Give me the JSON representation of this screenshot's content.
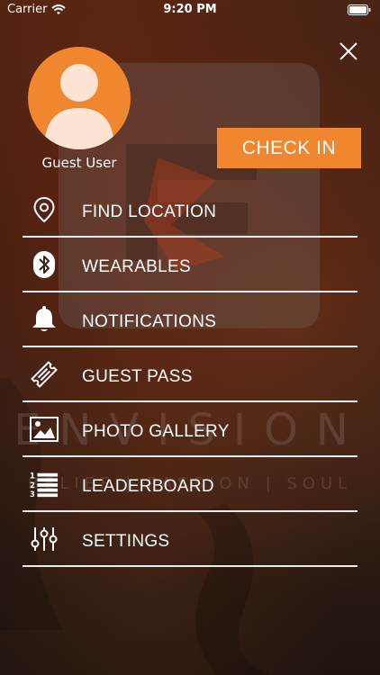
{
  "status_bar": {
    "carrier": "Carrier",
    "time": "9:20 PM"
  },
  "profile": {
    "name": "Guest User",
    "avatar_color": "#f0862d"
  },
  "check_in": {
    "label": "CHECK IN",
    "color": "#f0862d"
  },
  "menu": {
    "items": [
      {
        "label": "FIND LOCATION",
        "icon": "location-pin-icon"
      },
      {
        "label": "WEARABLES",
        "icon": "bluetooth-icon"
      },
      {
        "label": "NOTIFICATIONS",
        "icon": "bell-icon"
      },
      {
        "label": "GUEST PASS",
        "icon": "ticket-icon"
      },
      {
        "label": "PHOTO GALLERY",
        "icon": "image-icon"
      },
      {
        "label": "LEADERBOARD",
        "icon": "numbered-list-icon"
      },
      {
        "label": "SETTINGS",
        "icon": "sliders-icon"
      }
    ]
  },
  "background": {
    "brand_name": "ENVISION",
    "tagline": "BELIEF | PASSION | SOUL"
  }
}
